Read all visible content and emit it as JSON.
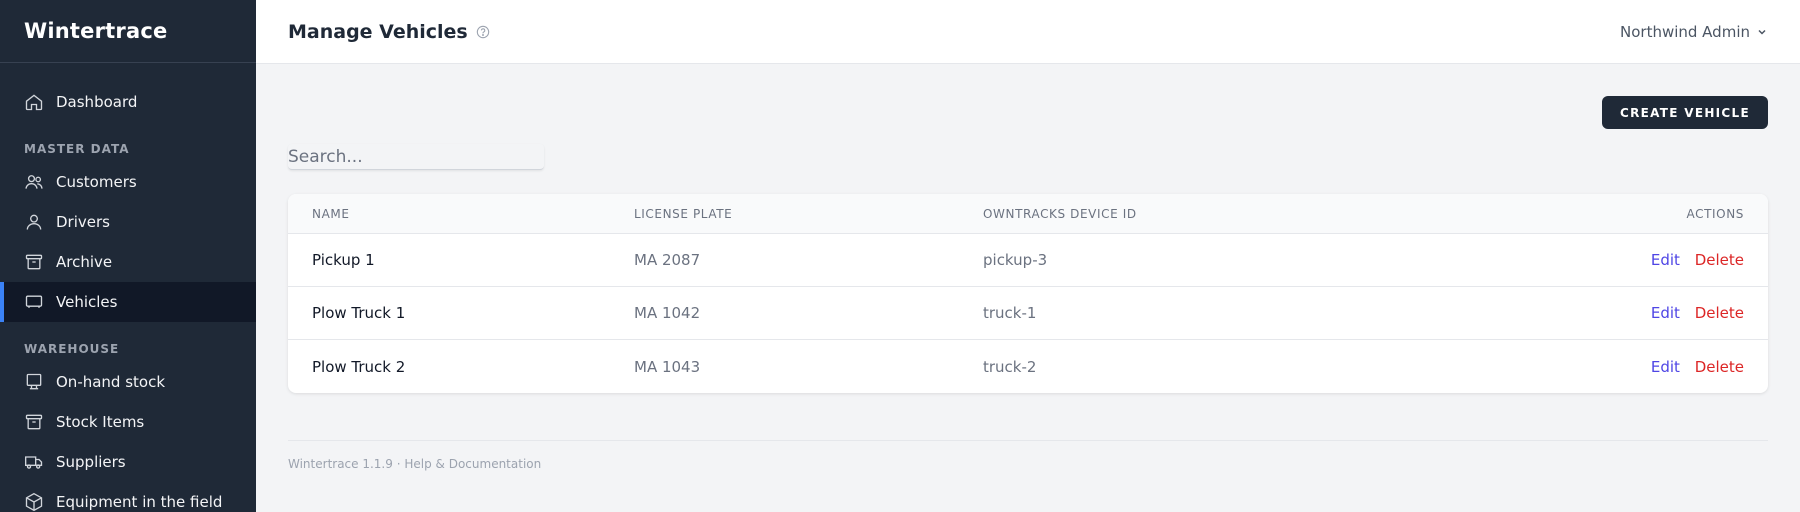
{
  "app": {
    "name": "Wintertrace"
  },
  "sidebar": {
    "dashboard": {
      "label": "Dashboard",
      "icon": "home-icon"
    },
    "sections": [
      {
        "title": "MASTER DATA",
        "items": [
          {
            "label": "Customers",
            "icon": "users-icon"
          },
          {
            "label": "Drivers",
            "icon": "user-icon"
          },
          {
            "label": "Archive",
            "icon": "archive-icon"
          },
          {
            "label": "Vehicles",
            "icon": "vehicle-icon",
            "active": true
          }
        ]
      },
      {
        "title": "WAREHOUSE",
        "items": [
          {
            "label": "On-hand stock",
            "icon": "stock-icon"
          },
          {
            "label": "Stock Items",
            "icon": "box-icon"
          },
          {
            "label": "Suppliers",
            "icon": "truck-icon"
          },
          {
            "label": "Equipment in the field",
            "icon": "cube-icon"
          }
        ]
      }
    ]
  },
  "header": {
    "title": "Manage Vehicles",
    "user": "Northwind Admin"
  },
  "toolbar": {
    "create_label": "CREATE VEHICLE"
  },
  "search": {
    "placeholder": "Search..."
  },
  "table": {
    "columns": [
      "NAME",
      "LICENSE PLATE",
      "OWNTRACKS DEVICE ID",
      "ACTIONS"
    ],
    "rows": [
      {
        "name": "Pickup 1",
        "plate": "MA 2087",
        "device": "pickup-3",
        "edit": "Edit",
        "delete": "Delete"
      },
      {
        "name": "Plow Truck 1",
        "plate": "MA 1042",
        "device": "truck-1",
        "edit": "Edit",
        "delete": "Delete"
      },
      {
        "name": "Plow Truck 2",
        "plate": "MA 1043",
        "device": "truck-2",
        "edit": "Edit",
        "delete": "Delete"
      }
    ]
  },
  "footer": {
    "version": "Wintertrace 1.1.9",
    "separator": "·",
    "help": "Help & Documentation"
  },
  "colors": {
    "sidebar": "#1f2937",
    "active_accent": "#3b82f6",
    "edit": "#4f46e5",
    "delete": "#dc2626"
  }
}
